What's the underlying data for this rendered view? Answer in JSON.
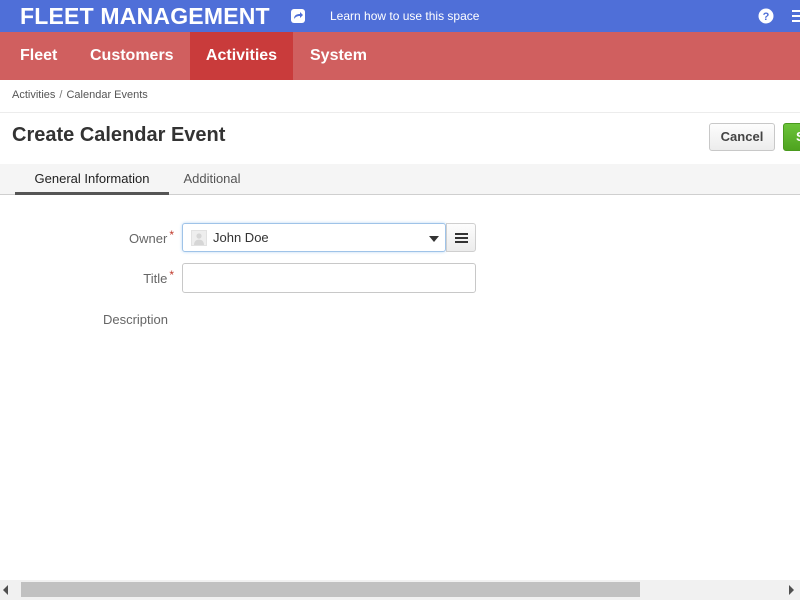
{
  "header": {
    "app_title": "FLEET MANAGEMENT",
    "learn_link": "Learn how to use this space",
    "icons": {
      "share": "share-arrow-icon",
      "help": "help-icon",
      "menu": "menu-icon"
    }
  },
  "nav": {
    "items": [
      {
        "label": "Fleet",
        "active": false
      },
      {
        "label": "Customers",
        "active": false
      },
      {
        "label": "Activities",
        "active": true
      },
      {
        "label": "System",
        "active": false
      }
    ]
  },
  "breadcrumb": {
    "items": [
      "Activities",
      "Calendar Events"
    ],
    "separator": "/"
  },
  "page": {
    "title": "Create Calendar Event",
    "cancel_label": "Cancel",
    "save_label": "Save"
  },
  "tabs": [
    {
      "label": "General Information",
      "active": true
    },
    {
      "label": "Additional",
      "active": false
    }
  ],
  "form": {
    "owner": {
      "label": "Owner",
      "required_mark": "*",
      "value": "John Doe"
    },
    "title": {
      "label": "Title",
      "required_mark": "*",
      "value": "",
      "placeholder": ""
    },
    "description": {
      "label": "Description"
    }
  },
  "colors": {
    "topbar": "#4f6fd8",
    "nav": "#d05f5f",
    "nav_active": "#c93b3b",
    "save": "#5cb82a",
    "required": "#c0392b"
  }
}
